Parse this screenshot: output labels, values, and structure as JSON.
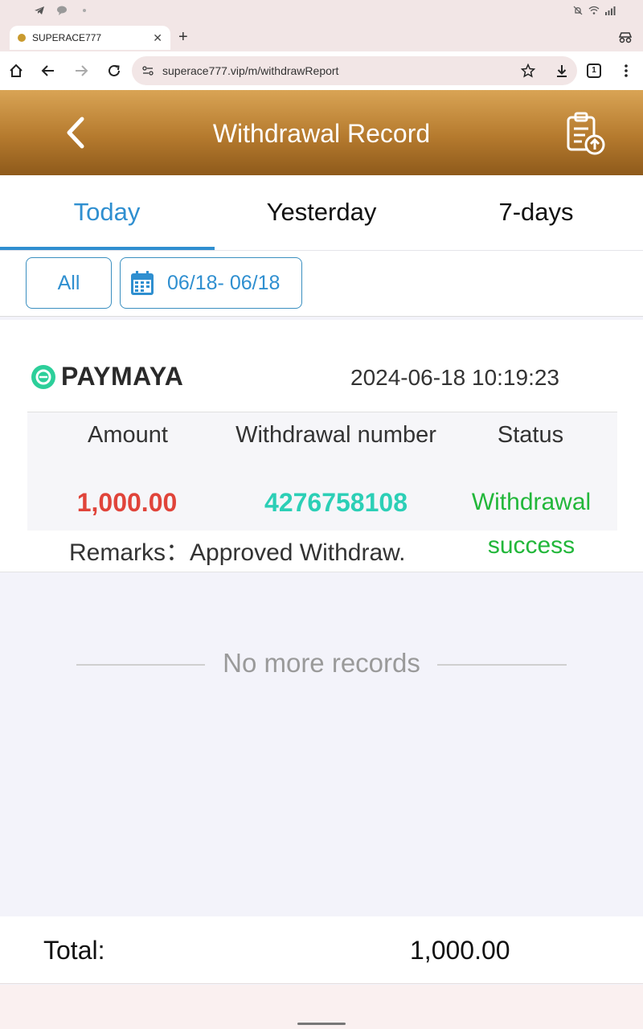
{
  "browser": {
    "tab_title": "SUPERACE777",
    "url": "superace777.vip/m/withdrawReport",
    "tab_count": "1"
  },
  "header": {
    "title": "Withdrawal Record"
  },
  "day_tabs": [
    {
      "label": "Today",
      "active": true
    },
    {
      "label": "Yesterday",
      "active": false
    },
    {
      "label": "7-days",
      "active": false
    }
  ],
  "filters": {
    "type": "All",
    "date_range": "06/18- 06/18"
  },
  "record": {
    "method": "PAYMAYA",
    "datetime": "2024-06-18 10:19:23",
    "columns": {
      "amount": "Amount",
      "number": "Withdrawal number",
      "status": "Status"
    },
    "amount": "1,000.00",
    "number": "4276758108",
    "status_line1": "Withdrawal",
    "status_line2": "success",
    "remarks": "Remarks：Approved Withdraw."
  },
  "footer_note": "No more records",
  "total": {
    "label": "Total:",
    "value": "1,000.00"
  },
  "colors": {
    "accent_blue": "#2f8fd0",
    "amount_red": "#e0443a",
    "number_teal": "#2ccfb6",
    "status_green": "#22b73a",
    "header_gold": "#b57a2e"
  }
}
